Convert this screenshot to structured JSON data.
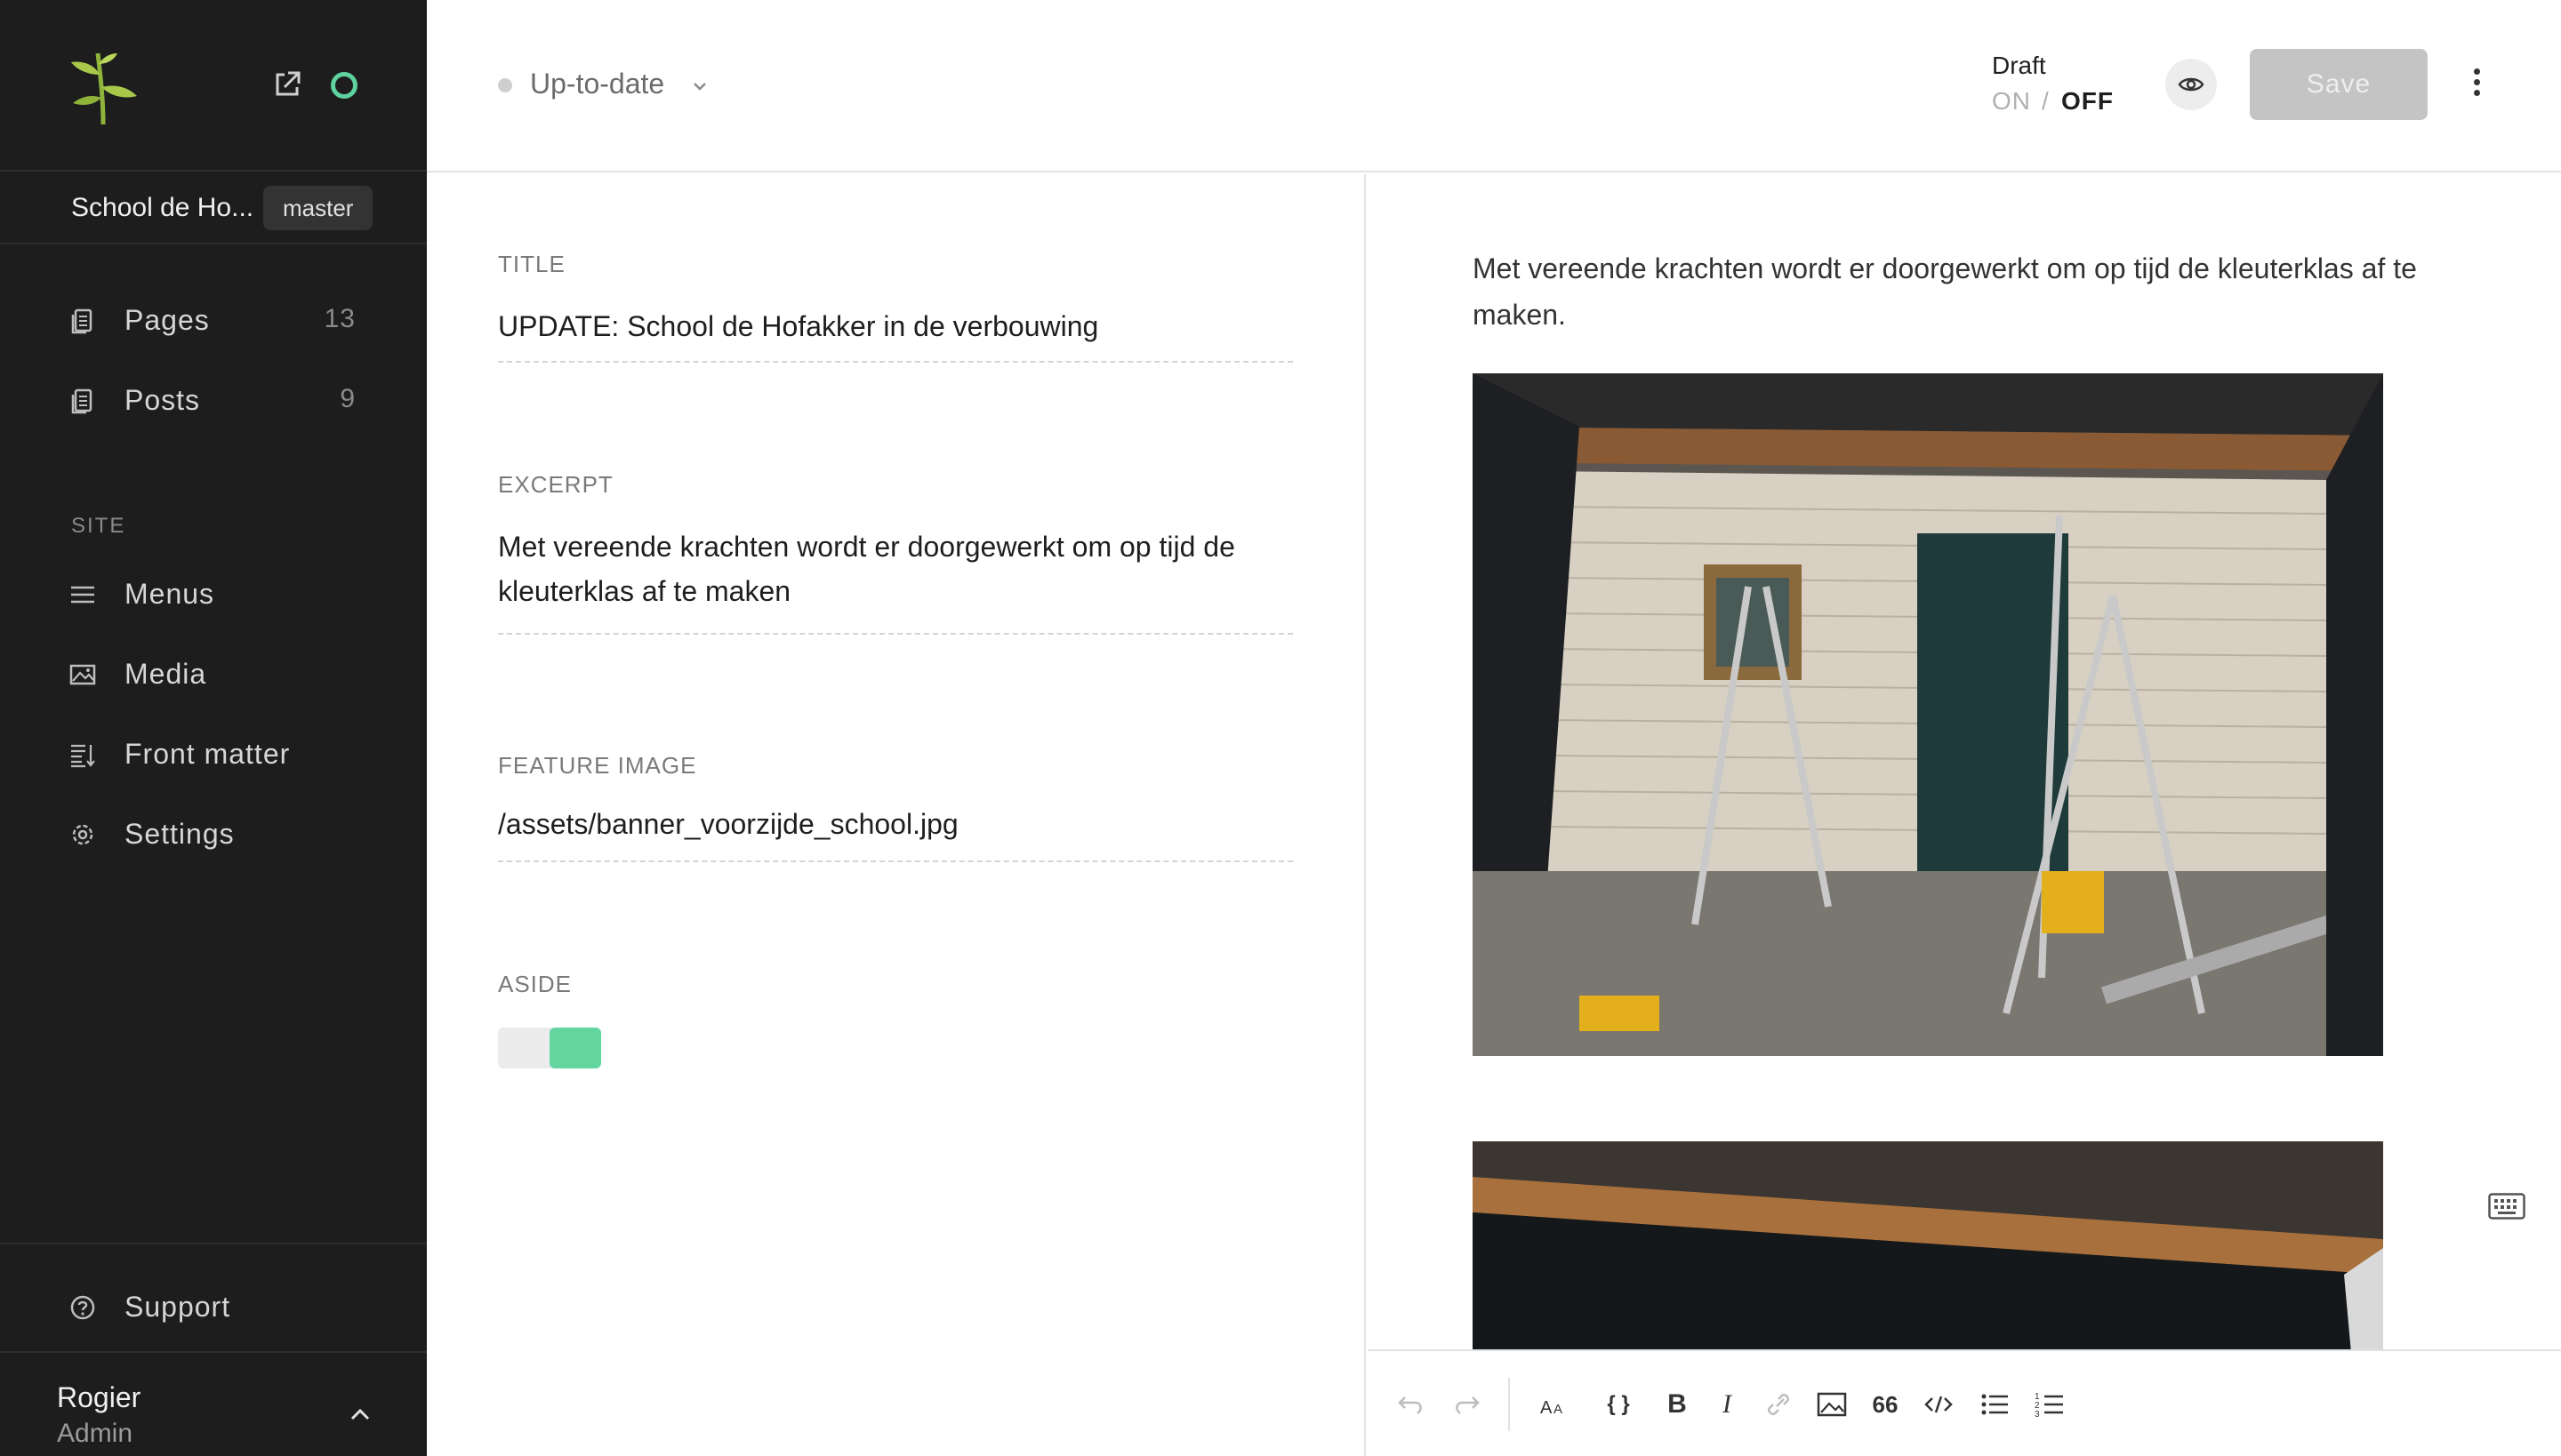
{
  "sidebar": {
    "site_name": "School de Ho...",
    "branch": "master",
    "items": [
      {
        "label": "Pages",
        "count": "13"
      },
      {
        "label": "Posts",
        "count": "9"
      }
    ],
    "section_label": "SITE",
    "site_items": [
      {
        "label": "Menus"
      },
      {
        "label": "Media"
      },
      {
        "label": "Front matter"
      },
      {
        "label": "Settings"
      }
    ],
    "support_label": "Support",
    "user": {
      "name": "Rogier",
      "role": "Admin"
    }
  },
  "header": {
    "status": "Up-to-date",
    "draft_label": "Draft",
    "draft_on": "ON",
    "draft_sep": "/",
    "draft_off": "OFF",
    "save_label": "Save"
  },
  "front_matter": {
    "title_label": "TITLE",
    "title_value": "UPDATE: School de Hofakker in de verbouwing",
    "excerpt_label": "EXCERPT",
    "excerpt_value": "Met vereende krachten wordt er doorgewerkt om op tijd de kleuterklas af te maken",
    "feature_label": "FEATURE IMAGE",
    "feature_value": "/assets/banner_voorzijde_school.jpg",
    "aside_label": "ASIDE",
    "aside_on": true
  },
  "editor": {
    "body_text": "Met vereende krachten wordt er doorgewerkt om op tijd de kleuterklas af te maken."
  },
  "toolbar": {
    "tools": [
      "undo-icon",
      "redo-icon",
      "text-size-icon",
      "braces-icon",
      "bold-icon",
      "italic-icon",
      "link-icon",
      "image-icon",
      "quote-icon",
      "code-icon",
      "bullet-list-icon",
      "numbered-list-icon"
    ],
    "bold_glyph": "B",
    "italic_glyph": "I",
    "quote_glyph": "66",
    "braces_glyph": "{ }"
  },
  "colors": {
    "sidebar_bg": "#1d1d1d",
    "accent_green": "#5fd2a0",
    "save_disabled": "#c4c4c4"
  }
}
